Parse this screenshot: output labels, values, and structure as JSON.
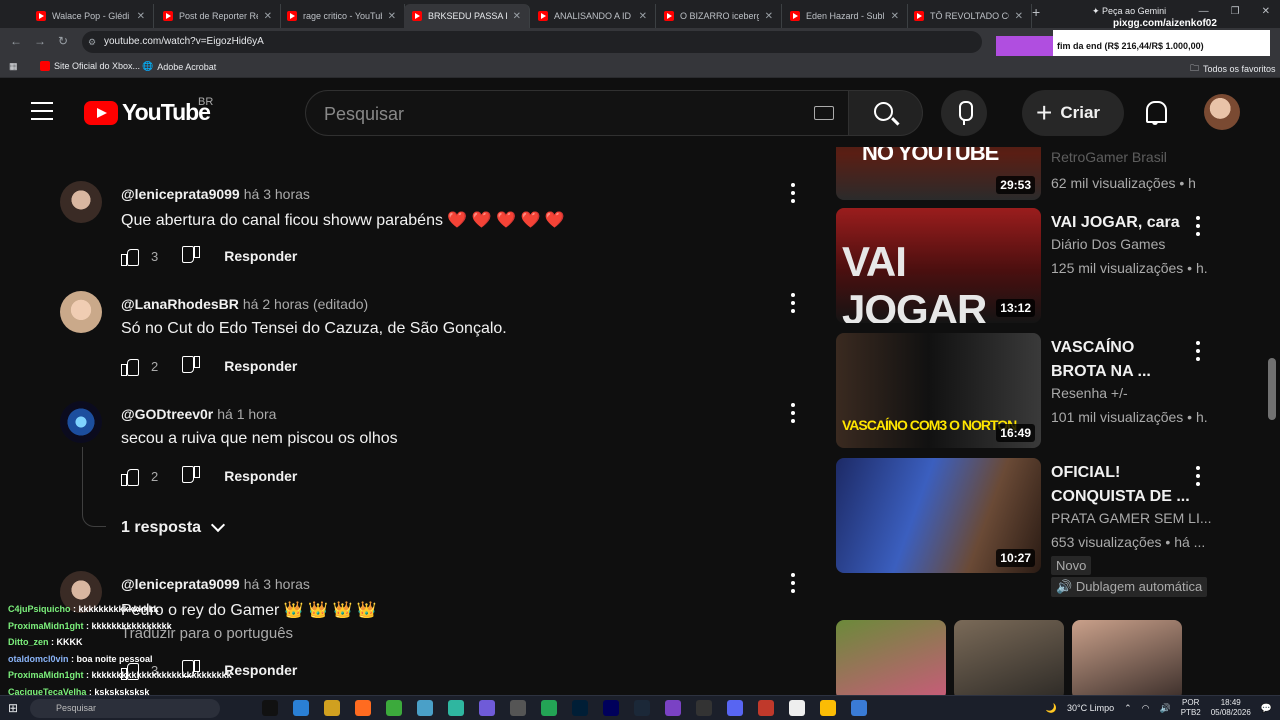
{
  "browser": {
    "tabs": [
      {
        "label": "Walace Pop - Glédi Ki"
      },
      {
        "label": "Post de Reporter Rese"
      },
      {
        "label": "rage critico - YouTube"
      },
      {
        "label": "BRKSEDU PASSA PAN"
      },
      {
        "label": "ANALISANDO A ID D"
      },
      {
        "label": "O BIZARRO iceberg d"
      },
      {
        "label": "Eden Hazard - Sublim"
      },
      {
        "label": "TÔ REVOLTADO COM"
      }
    ],
    "gemini_label": "Peça ao Gemini",
    "url": "youtube.com/watch?v=EigozHid6yA",
    "bookmarks": [
      {
        "label": "Site Oficial do Xbox..."
      },
      {
        "label": "Adobe Acrobat"
      }
    ],
    "all_bookmarks": "Todos os favoritos"
  },
  "overlay": {
    "pix_user": "pixgg.com/aizenkof02",
    "goal_text": "fim da end (R$ 216,44/R$ 1.000,00)",
    "goal_fraction": 0.2164
  },
  "header": {
    "logo_text": "YouTube",
    "country": "BR",
    "search_placeholder": "Pesquisar",
    "create_label": "Criar"
  },
  "comments": [
    {
      "author": "@leniceprata9099",
      "time": "há 3 horas",
      "text": "Que abertura do canal ficou showw parabéns ❤️ ❤️ ❤️ ❤️ ❤️",
      "likes": "3",
      "reply": "Responder"
    },
    {
      "author": "@LanaRhodesBR",
      "time": "há 2 horas (editado)",
      "text": "Só no Cut do Edo Tensei do Cazuza, de São Gonçalo.",
      "likes": "2",
      "reply": "Responder"
    },
    {
      "author": "@GODtreev0r",
      "time": "há 1 hora",
      "text": "secou a ruiva que nem piscou os olhos",
      "likes": "2",
      "reply": "Responder"
    },
    {
      "author": "@leniceprata9099",
      "time": "há 3 horas",
      "text": "Pedro o rey do Gamer 👑 👑 👑 👑",
      "likes": "3",
      "reply": "Responder",
      "translate": "Traduzir para o português"
    }
  ],
  "replies_toggle": "1 resposta",
  "sidebar": {
    "videos": [
      {
        "title": "",
        "thumb_text": "NO YOUTUBE",
        "channel": "RetroGamer Brasil",
        "views": "62 mil visualizações • h",
        "duration": "29:53"
      },
      {
        "title": "VAI JOGAR, cara",
        "thumb_text": "VAI JOGAR",
        "channel": "Diário Dos Games",
        "views": "125 mil visualizações • h.",
        "duration": "13:12"
      },
      {
        "title": "VASCAÍNO BROTA NA ...",
        "thumb_text": "VASCAÍNO COM3 O NORTON",
        "channel": "Resenha +/-",
        "views": "101 mil visualizações • h.",
        "duration": "16:49"
      },
      {
        "title": "OFICIAL! CONQUISTA DE ...",
        "thumb_text": "",
        "channel": "PRATA GAMER SEM LI...",
        "views": "653 visualizações • há ...",
        "duration": "10:27",
        "badge_new": "Novo",
        "badge_dub": "Dublagem automática"
      }
    ]
  },
  "chat": [
    {
      "user": "C4juPsiquicho",
      "msg": "kkkkkkkkkkkkkkkk"
    },
    {
      "user": "ProximaMidn1ght",
      "msg": "kkkkkkkkkkkkkkkk"
    },
    {
      "user": "Ditto_zen",
      "msg": "KKKK"
    },
    {
      "user": "otaldomcl0vin",
      "msg": "boa noite pessoal"
    },
    {
      "user": "ProximaMidn1ght",
      "msg": "kkkkkkkkkkkkkkkkkkkkkkkkkkkk"
    },
    {
      "user": "CaciqueTecaVelha",
      "msg": "ksksksksksk"
    }
  ],
  "taskbar": {
    "search_placeholder": "Pesquisar",
    "weather": "30°C  Limpo",
    "lang": "POR",
    "lang2": "PTB2",
    "time": "18:49",
    "date": "05/08/2026"
  },
  "colors": {
    "brand_red": "#ff0000",
    "background": "#0f0f0f",
    "goal_bar": "#b04ee0"
  }
}
